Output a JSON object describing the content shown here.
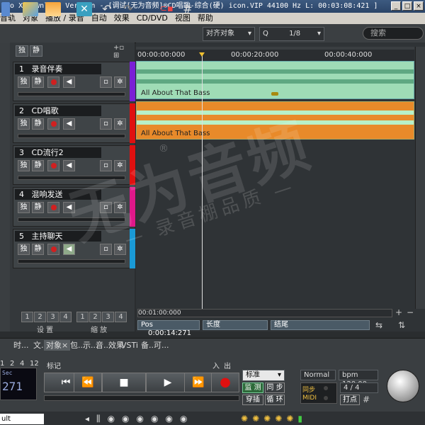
{
  "window": {
    "title": "Pro X Download Version - [调试[无为音频]®CD唱歌-综合(硬) icon.VIP   44100 Hz L: 00:03:08:421 ]"
  },
  "menu": {
    "items": [
      "音轨",
      "对象",
      "播放 / 录音",
      "自动",
      "效果",
      "CD/DVD",
      "视图",
      "帮助"
    ]
  },
  "toolbar": {
    "snap_label": "对齐对象",
    "zoom_value": "1/8",
    "search_placeholder": "搜索"
  },
  "track_header": {
    "solo": "独",
    "mute": "静"
  },
  "tracks": [
    {
      "num": "1",
      "name": "录音伴奏",
      "solo": "独",
      "mute": "静",
      "color": "#7a1fd6"
    },
    {
      "num": "2",
      "name": "CD唱歌",
      "solo": "独",
      "mute": "静",
      "color": "#e01010"
    },
    {
      "num": "3",
      "name": "CD流行2",
      "solo": "独",
      "mute": "静",
      "color": "#e01010"
    },
    {
      "num": "4",
      "name": "混响发送",
      "solo": "独",
      "mute": "静",
      "color": "#e0188a"
    },
    {
      "num": "5",
      "name": "主持聊天",
      "solo": "独",
      "mute": "静",
      "color": "#1a9ad6"
    }
  ],
  "ruler": {
    "ticks": [
      "00:00:00:000",
      "00:00:20:000",
      "00:00:40:000"
    ]
  },
  "clips": [
    {
      "label": "All About That Bass"
    },
    {
      "label": "All About That Bass"
    }
  ],
  "hscroll": {
    "time": "00:01:00:000"
  },
  "status": {
    "pos_label": "Pos",
    "pos_value": "0:00:14:271",
    "length_label": "长度",
    "end_label": "结尾"
  },
  "zoom": {
    "settings_label": "设 置",
    "zoom_label": "缩 放",
    "nums": [
      "1",
      "2",
      "3",
      "4"
    ]
  },
  "tabs": [
    "时...",
    "文...",
    "对象",
    "包...",
    "示...",
    "音...",
    "效果",
    "VSTi",
    "备...",
    "可..."
  ],
  "transport": {
    "lcd_label": "Sec",
    "lcd_value": "271",
    "marker_label": "标记",
    "in_label": "入",
    "out_label": "出",
    "num_markers": [
      "1",
      "2",
      "4",
      "12"
    ],
    "mode_select": "标准",
    "monitor": "监 测",
    "sync": "同 步",
    "punch": "穿插",
    "loop": "循 环",
    "normal": "Normal",
    "bpm": "bpm 120.00",
    "signature": "4 / 4",
    "sync_label": "同步",
    "midi_label": "MIDI",
    "click_label": "打点"
  },
  "bottom": {
    "select_value": "ult"
  },
  "watermark": {
    "main": "无为音频",
    "sub": "— 录音棚品质 —",
    "reg": "®"
  },
  "colors": {
    "clip1": "#9fdcb6",
    "clip2": "#e88a2a",
    "accent": "#2d6a3a"
  }
}
